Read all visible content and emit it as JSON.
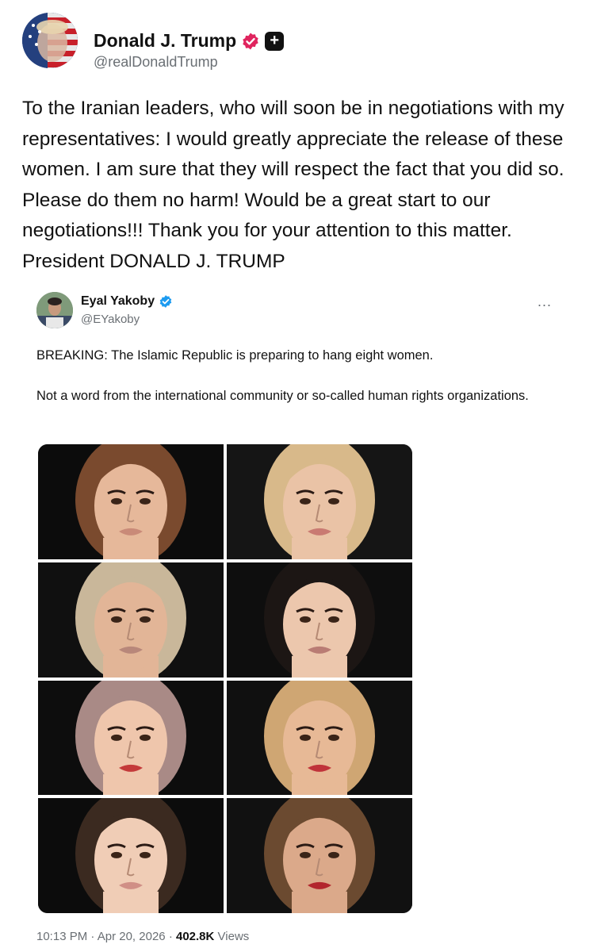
{
  "post": {
    "author": {
      "name": "Donald J. Trump",
      "handle": "@realDonaldTrump"
    },
    "badges": [
      "verified-check-icon",
      "truth-plus-icon"
    ],
    "text": "To the Iranian leaders, who will soon be in negotiations with my representatives: I would greatly appreciate the release of these women. I am sure that they will respect the fact that you did so. Please do them no harm! Would be a great start to our negotiations!!! Thank you for your attention to this matter. President DONALD J. TRUMP"
  },
  "quoted": {
    "author": {
      "name": "Eyal Yakoby",
      "handle": "@EYakoby"
    },
    "more_icon": "...",
    "paragraph1": "BREAKING: The Islamic Republic is preparing to hang eight women.",
    "paragraph2": "Not a word from the international community or so-called human rights organizations.",
    "photos": [
      {
        "hair": "#7a4a2e",
        "skin": "#e6b89a",
        "lips": "#c98a78",
        "bg": "#0c0c0c"
      },
      {
        "hair": "#d8b98a",
        "skin": "#eac3a6",
        "lips": "#c97a72",
        "bg": "#151515"
      },
      {
        "hair": "#c9b79a",
        "skin": "#e2b597",
        "lips": "#b8877a",
        "bg": "#101010"
      },
      {
        "hair": "#1c1614",
        "skin": "#ecc7ad",
        "lips": "#b97c74",
        "bg": "#0e0e0e"
      },
      {
        "hair": "#a98a86",
        "skin": "#efc6ac",
        "lips": "#c43a3a",
        "bg": "#0d0d0d"
      },
      {
        "hair": "#cfa673",
        "skin": "#e7b996",
        "lips": "#c0333a",
        "bg": "#101010"
      },
      {
        "hair": "#3b2a20",
        "skin": "#f0cdb6",
        "lips": "#d08f86",
        "bg": "#0c0c0c"
      },
      {
        "hair": "#6b4a30",
        "skin": "#dba98a",
        "lips": "#b2262d",
        "bg": "#111111"
      }
    ],
    "time": "10:13 PM",
    "separator": "·",
    "date": "Apr 20, 2026",
    "views_count": "402.8K",
    "views_label": "Views"
  },
  "colors": {
    "verified_pink": "#e0245e",
    "verified_blue": "#1d9bf0",
    "muted_text": "#6a6f74"
  }
}
